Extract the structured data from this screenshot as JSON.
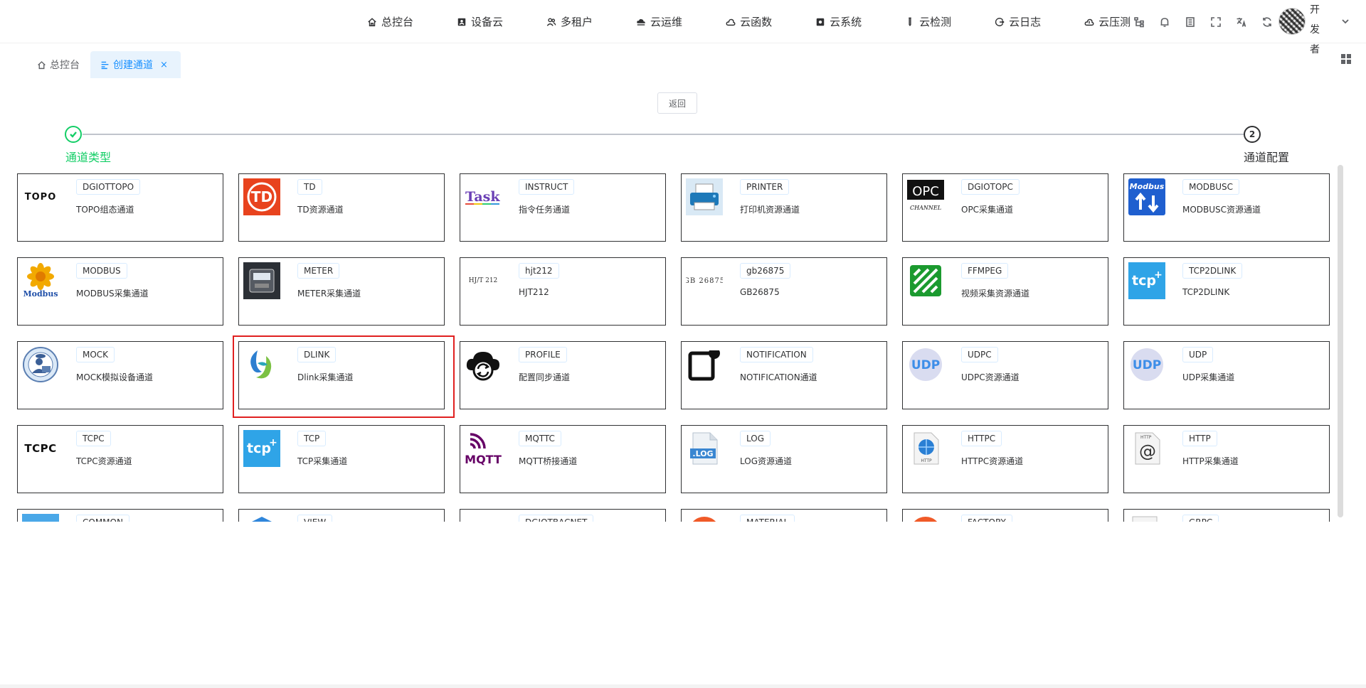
{
  "nav": {
    "items": [
      {
        "label": "总控台",
        "icon": "home-icon"
      },
      {
        "label": "设备云",
        "icon": "device-icon"
      },
      {
        "label": "多租户",
        "icon": "users-icon"
      },
      {
        "label": "云运维",
        "icon": "cloud-ops-icon"
      },
      {
        "label": "云函数",
        "icon": "cloud-function-icon"
      },
      {
        "label": "云系统",
        "icon": "cloud-system-icon"
      },
      {
        "label": "云检测",
        "icon": "test-tube-icon"
      },
      {
        "label": "云日志",
        "icon": "log-icon"
      },
      {
        "label": "云压测",
        "icon": "cloud-stress-icon"
      }
    ],
    "tools": [
      "tree-icon",
      "bell-icon",
      "book-icon",
      "fullscreen-icon",
      "translate-icon",
      "refresh-icon"
    ],
    "user_name": "开发者"
  },
  "tabs": {
    "home": "总控台",
    "active": "创建通道",
    "close": "×"
  },
  "back_label": "返回",
  "steps": {
    "step1_title": "通道类型",
    "step2_number": "2",
    "step2_title": "通道配置"
  },
  "colors": {
    "step_done": "#13ce66",
    "accent": "#1890ff",
    "highlight": "#e02020"
  },
  "channels": [
    {
      "tag": "DGIOTTOPO",
      "desc": "TOPO组态通道",
      "icon": "topo-logo-icon"
    },
    {
      "tag": "TD",
      "desc": "TD资源通道",
      "icon": "td-logo-icon"
    },
    {
      "tag": "INSTRUCT",
      "desc": "指令任务通道",
      "icon": "task-logo-icon"
    },
    {
      "tag": "PRINTER",
      "desc": "打印机资源通道",
      "icon": "printer-icon"
    },
    {
      "tag": "DGIOTOPC",
      "desc": "OPC采集通道",
      "icon": "opc-logo-icon"
    },
    {
      "tag": "MODBUSC",
      "desc": "MODBUSC资源通道",
      "icon": "modbus-arrows-icon"
    },
    {
      "tag": "MODBUS",
      "desc": "MODBUS采集通道",
      "icon": "modbus-flower-icon"
    },
    {
      "tag": "METER",
      "desc": "METER采集通道",
      "icon": "meter-icon"
    },
    {
      "tag": "hjt212",
      "desc": "HJT212",
      "icon": "hjt212-text-icon"
    },
    {
      "tag": "gb26875",
      "desc": "GB26875",
      "icon": "gb26875-text-icon"
    },
    {
      "tag": "FFMPEG",
      "desc": "视频采集资源通道",
      "icon": "ffmpeg-logo-icon"
    },
    {
      "tag": "TCP2DLINK",
      "desc": "TCP2DLINK",
      "icon": "tcp-plus-icon"
    },
    {
      "tag": "MOCK",
      "desc": "MOCK模拟设备通道",
      "icon": "mock-user-icon"
    },
    {
      "tag": "DLINK",
      "desc": "Dlink采集通道",
      "icon": "dlink-logo-icon"
    },
    {
      "tag": "PROFILE",
      "desc": "配置同步通道",
      "icon": "cloud-sync-icon"
    },
    {
      "tag": "NOTIFICATION",
      "desc": "NOTIFICATION通道",
      "icon": "notification-icon"
    },
    {
      "tag": "UDPC",
      "desc": "UDPC资源通道",
      "icon": "udp-bubble-icon"
    },
    {
      "tag": "UDP",
      "desc": "UDP采集通道",
      "icon": "udp-bubble-icon"
    },
    {
      "tag": "TCPC",
      "desc": "TCPC资源通道",
      "icon": "tcpc-text-icon"
    },
    {
      "tag": "TCP",
      "desc": "TCP采集通道",
      "icon": "tcp-plus-icon"
    },
    {
      "tag": "MQTTC",
      "desc": "MQTT桥接通道",
      "icon": "mqtt-logo-icon"
    },
    {
      "tag": "LOG",
      "desc": "LOG资源通道",
      "icon": "log-file-icon"
    },
    {
      "tag": "HTTPC",
      "desc": "HTTPC资源通道",
      "icon": "http-globe-icon"
    },
    {
      "tag": "HTTP",
      "desc": "HTTP采集通道",
      "icon": "http-at-icon"
    },
    {
      "tag": "COMMON",
      "desc": "",
      "icon": "common-icon"
    },
    {
      "tag": "VIEW",
      "desc": "",
      "icon": "view-icon"
    },
    {
      "tag": "DGIOTBACNET",
      "desc": "",
      "icon": "bacnet-icon"
    },
    {
      "tag": "MATERIAL",
      "desc": "",
      "icon": "material-icon"
    },
    {
      "tag": "FACTORY",
      "desc": "",
      "icon": "factory-icon"
    },
    {
      "tag": "GRPC",
      "desc": "",
      "icon": "grpc-icon"
    }
  ],
  "icon_text": {
    "topo": "TOPO",
    "td": "TD",
    "task": "Task",
    "opc": "OPC",
    "opc_sub": "CHANNEL",
    "modbus_word": "Modbus",
    "hjt212": "HJ/T 212",
    "gb26875": "GB 26875",
    "tcp": "tcp",
    "udp": "UDP",
    "tcpc": "TCPC",
    "mqtt": "MQTT",
    "log": ".LOG",
    "http": "HTTP"
  }
}
